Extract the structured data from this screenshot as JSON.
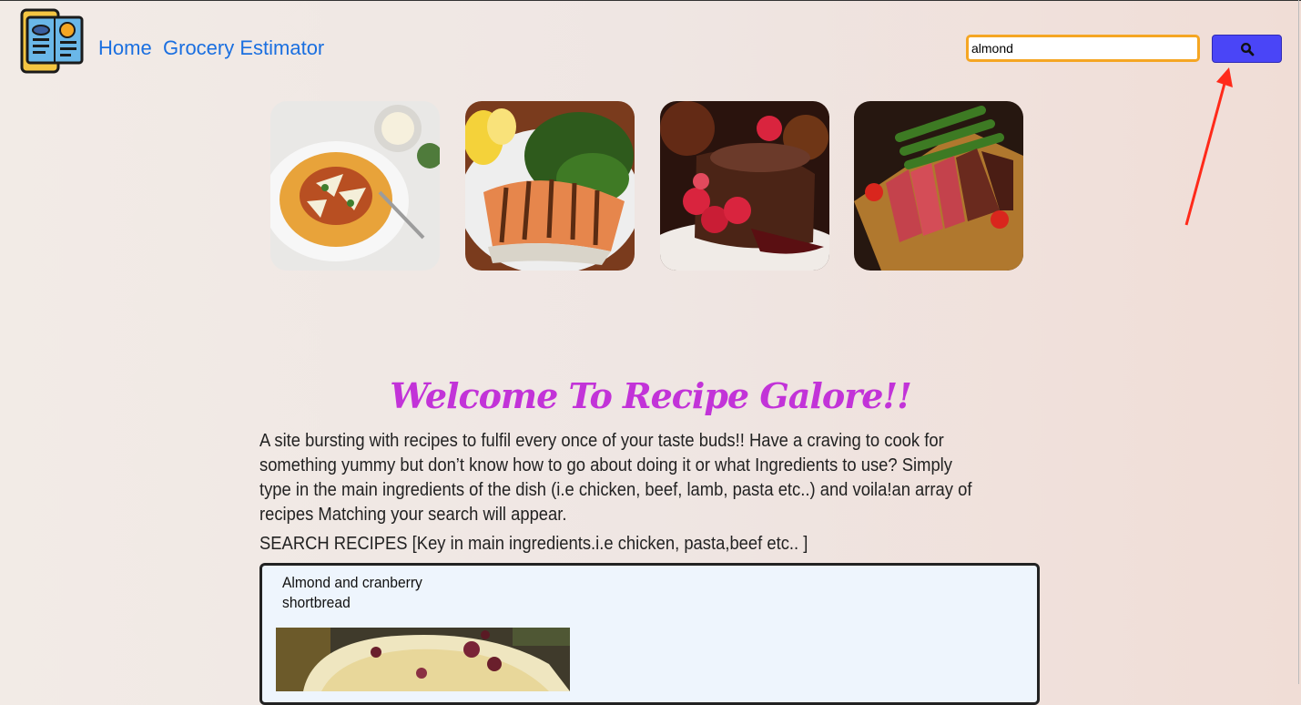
{
  "nav": {
    "home_label": "Home",
    "grocery_label": "Grocery Estimator"
  },
  "search": {
    "value": "almond",
    "button_icon": "search-icon"
  },
  "gallery": {
    "items": [
      "pasta-dish-image",
      "grilled-salmon-image",
      "chocolate-lava-cake-image",
      "sliced-steak-image"
    ]
  },
  "main": {
    "welcome": "Welcome To Recipe Galore!!",
    "intro": "A site bursting with recipes to fulfil every once of your taste buds!! Have a craving to cook for something yummy but don’t know how to go about doing it or what Ingredients to use? Simply type in the main ingredients of the dish (i.e chicken, beef, lamb, pasta etc..) and voila!an array of recipes Matching your search will appear.",
    "search_label": "SEARCH RECIPES [Key in main ingredients.i.e chicken, pasta,beef etc.. ]"
  },
  "results": [
    {
      "title": "Almond and cranberry shortbread"
    }
  ],
  "colors": {
    "accent_link": "#1a6fe0",
    "welcome": "#c233d8",
    "search_button": "#4a45f7",
    "input_border": "#f5a623",
    "annotation_arrow": "#ff2a1a"
  }
}
